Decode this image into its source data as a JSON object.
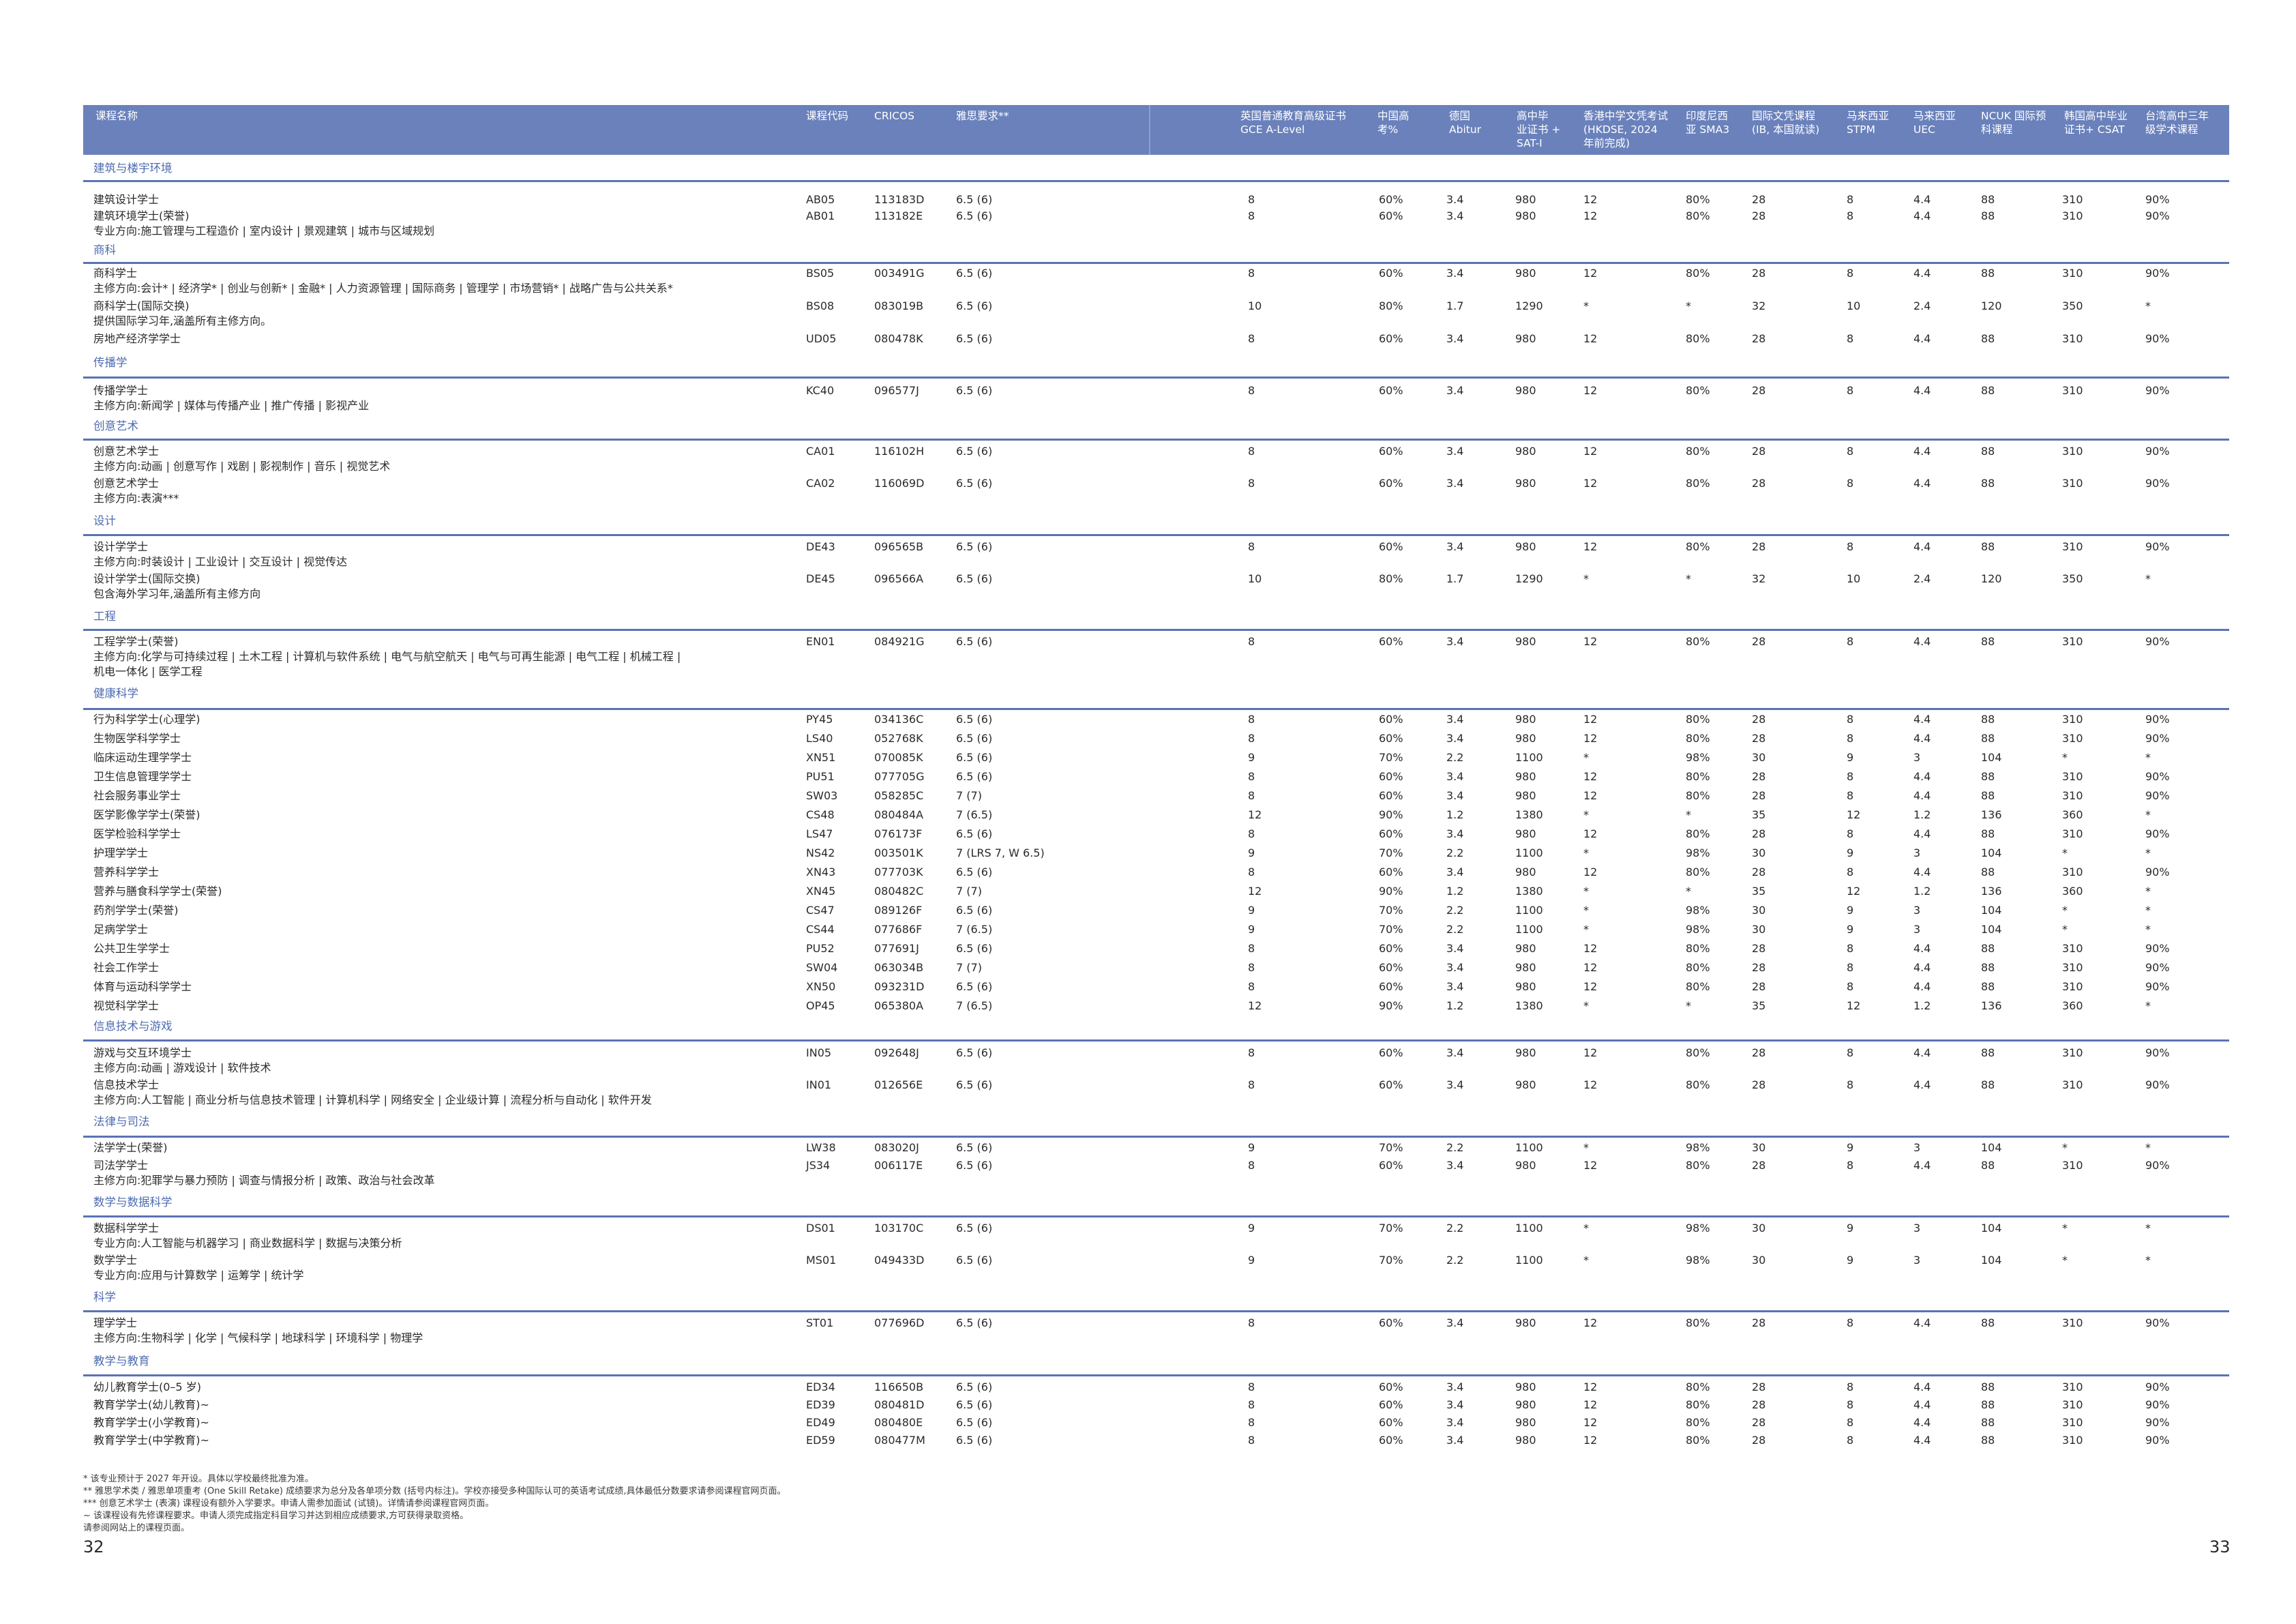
{
  "header": {
    "columns": [
      "课程名称",
      "课程代码",
      "CRICOS",
      "雅思要求**",
      "英国普通教育高级证书\nGCE A-Level",
      "中国高\n考%",
      "德国\nAbitur",
      "高中毕\n业证书 +\nSAT-I",
      "香港中学文凭考试\n(HKDSE, 2024\n年前完成)",
      "印度尼西\n亚 SMA3",
      "国际文凭课程\n(IB, 本国就读)",
      "马来西亚\nSTPM",
      "马来西亚\nUEC",
      "NCUK 国际预\n科课程",
      "韩国高中毕业\n证书+ CSAT",
      "台湾高中三年\n级学术课程"
    ]
  },
  "sections": [
    {
      "title": "建筑与楼宇环境",
      "rows": [
        {
          "name": "建筑设计学士",
          "code": "AB05",
          "cricos": "113183D",
          "ielts": "6.5 (6)",
          "vals": [
            "8",
            "60%",
            "3.4",
            "980",
            "12",
            "80%",
            "28",
            "8",
            "4.4",
            "88",
            "310",
            "90%"
          ]
        },
        {
          "name": "建筑环境学士(荣誉)",
          "sub": [
            "专业方向:施工管理与工程造价 | 室内设计 | 景观建筑 | 城市与区域规划"
          ],
          "code": "AB01",
          "cricos": "113182E",
          "ielts": "6.5 (6)",
          "vals": [
            "8",
            "60%",
            "3.4",
            "980",
            "12",
            "80%",
            "28",
            "8",
            "4.4",
            "88",
            "310",
            "90%"
          ]
        }
      ]
    },
    {
      "title": "商科",
      "rows": [
        {
          "name": "商科学士",
          "sub": [
            "主修方向:会计* | 经济学* | 创业与创新* | 金融* | 人力资源管理 | 国际商务 | 管理学 | 市场营销* | 战略广告与公共关系*"
          ],
          "code": "BS05",
          "cricos": "003491G",
          "ielts": "6.5 (6)",
          "vals": [
            "8",
            "60%",
            "3.4",
            "980",
            "12",
            "80%",
            "28",
            "8",
            "4.4",
            "88",
            "310",
            "90%"
          ]
        },
        {
          "name": "商科学士(国际交换)",
          "sub": [
            "提供国际学习年,涵盖所有主修方向。"
          ],
          "code": "BS08",
          "cricos": "083019B",
          "ielts": "6.5 (6)",
          "vals": [
            "10",
            "80%",
            "1.7",
            "1290",
            "*",
            "*",
            "32",
            "10",
            "2.4",
            "120",
            "350",
            "*"
          ]
        },
        {
          "name": "房地产经济学学士",
          "code": "UD05",
          "cricos": "080478K",
          "ielts": "6.5 (6)",
          "vals": [
            "8",
            "60%",
            "3.4",
            "980",
            "12",
            "80%",
            "28",
            "8",
            "4.4",
            "88",
            "310",
            "90%"
          ]
        }
      ]
    },
    {
      "title": "传播学",
      "rows": [
        {
          "name": "传播学学士",
          "sub": [
            "主修方向:新闻学 | 媒体与传播产业 | 推广传播 | 影视产业"
          ],
          "code": "KC40",
          "cricos": "096577J",
          "ielts": "6.5 (6)",
          "vals": [
            "8",
            "60%",
            "3.4",
            "980",
            "12",
            "80%",
            "28",
            "8",
            "4.4",
            "88",
            "310",
            "90%"
          ]
        }
      ]
    },
    {
      "title": "创意艺术",
      "rows": [
        {
          "name": "创意艺术学士",
          "sub": [
            "主修方向:动画 | 创意写作 | 戏剧 | 影视制作 | 音乐 | 视觉艺术"
          ],
          "code": "CA01",
          "cricos": "116102H",
          "ielts": "6.5 (6)",
          "vals": [
            "8",
            "60%",
            "3.4",
            "980",
            "12",
            "80%",
            "28",
            "8",
            "4.4",
            "88",
            "310",
            "90%"
          ]
        },
        {
          "name": "创意艺术学士",
          "sub": [
            "主修方向:表演***"
          ],
          "code": "CA02",
          "cricos": "116069D",
          "ielts": "6.5 (6)",
          "vals": [
            "8",
            "60%",
            "3.4",
            "980",
            "12",
            "80%",
            "28",
            "8",
            "4.4",
            "88",
            "310",
            "90%"
          ]
        }
      ]
    },
    {
      "title": "设计",
      "rows": [
        {
          "name": "设计学学士",
          "sub": [
            "主修方向:时装设计 | 工业设计 | 交互设计 | 视觉传达"
          ],
          "code": "DE43",
          "cricos": "096565B",
          "ielts": "6.5 (6)",
          "vals": [
            "8",
            "60%",
            "3.4",
            "980",
            "12",
            "80%",
            "28",
            "8",
            "4.4",
            "88",
            "310",
            "90%"
          ]
        },
        {
          "name": "设计学学士(国际交换)",
          "sub": [
            "包含海外学习年,涵盖所有主修方向"
          ],
          "code": "DE45",
          "cricos": "096566A",
          "ielts": "6.5 (6)",
          "vals": [
            "10",
            "80%",
            "1.7",
            "1290",
            "*",
            "*",
            "32",
            "10",
            "2.4",
            "120",
            "350",
            "*"
          ]
        }
      ]
    },
    {
      "title": "工程",
      "rows": [
        {
          "name": "工程学学士(荣誉)",
          "sub": [
            "主修方向:化学与可持续过程 | 土木工程 | 计算机与软件系统 | 电气与航空航天 | 电气与可再生能源 | 电气工程 | 机械工程 |",
            "机电一体化 | 医学工程"
          ],
          "code": "EN01",
          "cricos": "084921G",
          "ielts": "6.5 (6)",
          "vals": [
            "8",
            "60%",
            "3.4",
            "980",
            "12",
            "80%",
            "28",
            "8",
            "4.4",
            "88",
            "310",
            "90%"
          ]
        }
      ]
    },
    {
      "title": "健康科学",
      "rows": [
        {
          "name": "行为科学学士(心理学)",
          "code": "PY45",
          "cricos": "034136C",
          "ielts": "6.5 (6)",
          "vals": [
            "8",
            "60%",
            "3.4",
            "980",
            "12",
            "80%",
            "28",
            "8",
            "4.4",
            "88",
            "310",
            "90%"
          ]
        },
        {
          "name": "生物医学科学学士",
          "code": "LS40",
          "cricos": "052768K",
          "ielts": "6.5 (6)",
          "vals": [
            "8",
            "60%",
            "3.4",
            "980",
            "12",
            "80%",
            "28",
            "8",
            "4.4",
            "88",
            "310",
            "90%"
          ]
        },
        {
          "name": "临床运动生理学学士",
          "code": "XN51",
          "cricos": "070085K",
          "ielts": "6.5 (6)",
          "vals": [
            "9",
            "70%",
            "2.2",
            "1100",
            "*",
            "98%",
            "30",
            "9",
            "3",
            "104",
            "*",
            "*"
          ]
        },
        {
          "name": "卫生信息管理学学士",
          "code": "PU51",
          "cricos": "077705G",
          "ielts": "6.5 (6)",
          "vals": [
            "8",
            "60%",
            "3.4",
            "980",
            "12",
            "80%",
            "28",
            "8",
            "4.4",
            "88",
            "310",
            "90%"
          ]
        },
        {
          "name": "社会服务事业学士",
          "code": "SW03",
          "cricos": "058285C",
          "ielts": "7 (7)",
          "vals": [
            "8",
            "60%",
            "3.4",
            "980",
            "12",
            "80%",
            "28",
            "8",
            "4.4",
            "88",
            "310",
            "90%"
          ]
        },
        {
          "name": "医学影像学学士(荣誉)",
          "code": "CS48",
          "cricos": "080484A",
          "ielts": "7 (6.5)",
          "vals": [
            "12",
            "90%",
            "1.2",
            "1380",
            "*",
            "*",
            "35",
            "12",
            "1.2",
            "136",
            "360",
            "*"
          ]
        },
        {
          "name": "医学检验科学学士",
          "code": "LS47",
          "cricos": "076173F",
          "ielts": "6.5 (6)",
          "vals": [
            "8",
            "60%",
            "3.4",
            "980",
            "12",
            "80%",
            "28",
            "8",
            "4.4",
            "88",
            "310",
            "90%"
          ]
        },
        {
          "name": "护理学学士",
          "code": "NS42",
          "cricos": "003501K",
          "ielts": "7 (LRS 7, W 6.5)",
          "vals": [
            "9",
            "70%",
            "2.2",
            "1100",
            "*",
            "98%",
            "30",
            "9",
            "3",
            "104",
            "*",
            "*"
          ]
        },
        {
          "name": "营养科学学士",
          "code": "XN43",
          "cricos": "077703K",
          "ielts": "6.5 (6)",
          "vals": [
            "8",
            "60%",
            "3.4",
            "980",
            "12",
            "80%",
            "28",
            "8",
            "4.4",
            "88",
            "310",
            "90%"
          ]
        },
        {
          "name": "营养与膳食科学学士(荣誉)",
          "code": "XN45",
          "cricos": "080482C",
          "ielts": "7 (7)",
          "vals": [
            "12",
            "90%",
            "1.2",
            "1380",
            "*",
            "*",
            "35",
            "12",
            "1.2",
            "136",
            "360",
            "*"
          ]
        },
        {
          "name": "药剂学学士(荣誉)",
          "code": "CS47",
          "cricos": "089126F",
          "ielts": "6.5 (6)",
          "vals": [
            "9",
            "70%",
            "2.2",
            "1100",
            "*",
            "98%",
            "30",
            "9",
            "3",
            "104",
            "*",
            "*"
          ]
        },
        {
          "name": "足病学学士",
          "code": "CS44",
          "cricos": "077686F",
          "ielts": "7 (6.5)",
          "vals": [
            "9",
            "70%",
            "2.2",
            "1100",
            "*",
            "98%",
            "30",
            "9",
            "3",
            "104",
            "*",
            "*"
          ]
        },
        {
          "name": "公共卫生学学士",
          "code": "PU52",
          "cricos": "077691J",
          "ielts": "6.5 (6)",
          "vals": [
            "8",
            "60%",
            "3.4",
            "980",
            "12",
            "80%",
            "28",
            "8",
            "4.4",
            "88",
            "310",
            "90%"
          ]
        },
        {
          "name": "社会工作学士",
          "code": "SW04",
          "cricos": "063034B",
          "ielts": "7 (7)",
          "vals": [
            "8",
            "60%",
            "3.4",
            "980",
            "12",
            "80%",
            "28",
            "8",
            "4.4",
            "88",
            "310",
            "90%"
          ]
        },
        {
          "name": "体育与运动科学学士",
          "code": "XN50",
          "cricos": "093231D",
          "ielts": "6.5 (6)",
          "vals": [
            "8",
            "60%",
            "3.4",
            "980",
            "12",
            "80%",
            "28",
            "8",
            "4.4",
            "88",
            "310",
            "90%"
          ]
        },
        {
          "name": "视觉科学学士",
          "code": "OP45",
          "cricos": "065380A",
          "ielts": "7 (6.5)",
          "vals": [
            "12",
            "90%",
            "1.2",
            "1380",
            "*",
            "*",
            "35",
            "12",
            "1.2",
            "136",
            "360",
            "*"
          ]
        }
      ]
    },
    {
      "title": "信息技术与游戏",
      "rows": [
        {
          "name": "游戏与交互环境学士",
          "sub": [
            "主修方向:动画 | 游戏设计 | 软件技术"
          ],
          "code": "IN05",
          "cricos": "092648J",
          "ielts": "6.5 (6)",
          "vals": [
            "8",
            "60%",
            "3.4",
            "980",
            "12",
            "80%",
            "28",
            "8",
            "4.4",
            "88",
            "310",
            "90%"
          ]
        },
        {
          "name": "信息技术学士",
          "sub": [
            "主修方向:人工智能 | 商业分析与信息技术管理 | 计算机科学 | 网络安全 | 企业级计算 | 流程分析与自动化 | 软件开发"
          ],
          "code": "IN01",
          "cricos": "012656E",
          "ielts": "6.5 (6)",
          "vals": [
            "8",
            "60%",
            "3.4",
            "980",
            "12",
            "80%",
            "28",
            "8",
            "4.4",
            "88",
            "310",
            "90%"
          ]
        }
      ]
    },
    {
      "title": "法律与司法",
      "rows": [
        {
          "name": "法学学士(荣誉)",
          "code": "LW38",
          "cricos": "083020J",
          "ielts": "6.5 (6)",
          "vals": [
            "9",
            "70%",
            "2.2",
            "1100",
            "*",
            "98%",
            "30",
            "9",
            "3",
            "104",
            "*",
            "*"
          ]
        },
        {
          "name": "司法学学士",
          "sub": [
            "主修方向:犯罪学与暴力预防 | 调查与情报分析 | 政策、政治与社会改革"
          ],
          "code": "JS34",
          "cricos": "006117E",
          "ielts": "6.5 (6)",
          "vals": [
            "8",
            "60%",
            "3.4",
            "980",
            "12",
            "80%",
            "28",
            "8",
            "4.4",
            "88",
            "310",
            "90%"
          ]
        }
      ]
    },
    {
      "title": "数学与数据科学",
      "rows": [
        {
          "name": "数据科学学士",
          "sub": [
            "专业方向:人工智能与机器学习 | 商业数据科学 | 数据与决策分析"
          ],
          "code": "DS01",
          "cricos": "103170C",
          "ielts": "6.5 (6)",
          "vals": [
            "9",
            "70%",
            "2.2",
            "1100",
            "*",
            "98%",
            "30",
            "9",
            "3",
            "104",
            "*",
            "*"
          ]
        },
        {
          "name": "数学学士",
          "sub": [
            "专业方向:应用与计算数学 | 运筹学 | 统计学"
          ],
          "code": "MS01",
          "cricos": "049433D",
          "ielts": "6.5 (6)",
          "vals": [
            "9",
            "70%",
            "2.2",
            "1100",
            "*",
            "98%",
            "30",
            "9",
            "3",
            "104",
            "*",
            "*"
          ]
        }
      ]
    },
    {
      "title": "科学",
      "rows": [
        {
          "name": "理学学士",
          "sub": [
            "主修方向:生物科学 | 化学 | 气候科学 | 地球科学 | 环境科学 | 物理学"
          ],
          "code": "ST01",
          "cricos": "077696D",
          "ielts": "6.5 (6)",
          "vals": [
            "8",
            "60%",
            "3.4",
            "980",
            "12",
            "80%",
            "28",
            "8",
            "4.4",
            "88",
            "310",
            "90%"
          ]
        }
      ]
    },
    {
      "title": "教学与教育",
      "rows": [
        {
          "name": "幼儿教育学士(0–5 岁)",
          "code": "ED34",
          "cricos": "116650B",
          "ielts": "6.5 (6)",
          "vals": [
            "8",
            "60%",
            "3.4",
            "980",
            "12",
            "80%",
            "28",
            "8",
            "4.4",
            "88",
            "310",
            "90%"
          ]
        },
        {
          "name": "教育学学士(幼儿教育)~",
          "code": "ED39",
          "cricos": "080481D",
          "ielts": "6.5 (6)",
          "vals": [
            "8",
            "60%",
            "3.4",
            "980",
            "12",
            "80%",
            "28",
            "8",
            "4.4",
            "88",
            "310",
            "90%"
          ]
        },
        {
          "name": "教育学学士(小学教育)~",
          "code": "ED49",
          "cricos": "080480E",
          "ielts": "6.5 (6)",
          "vals": [
            "8",
            "60%",
            "3.4",
            "980",
            "12",
            "80%",
            "28",
            "8",
            "4.4",
            "88",
            "310",
            "90%"
          ]
        },
        {
          "name": "教育学学士(中学教育)~",
          "code": "ED59",
          "cricos": "080477M",
          "ielts": "6.5 (6)",
          "vals": [
            "8",
            "60%",
            "3.4",
            "980",
            "12",
            "80%",
            "28",
            "8",
            "4.4",
            "88",
            "310",
            "90%"
          ]
        }
      ]
    }
  ],
  "footnotes": [
    "*    该专业预计于 2027 年开设。具体以学校最终批准为准。",
    "**   雅思学术类 / 雅思单项重考 (One Skill Retake) 成绩要求为总分及各单项分数 (括号内标注)。学校亦接受多种国际认可的英语考试成绩,具体最低分数要求请参阅课程官网页面。",
    "***  创意艺术学士 (表演) 课程设有额外入学要求。申请人需参加面试 (试镜)。详情请参阅课程官网页面。",
    "~    该课程设有先修课程要求。申请人须完成指定科目学习并达到相应成绩要求,方可获得录取资格。",
    "请参阅网站上的课程页面。"
  ],
  "page_numbers": {
    "left": "32",
    "right": "33"
  },
  "colors": {
    "header_bg": "#6a81bb",
    "section_title": "#4d6bb0",
    "rule": "#5a73b3"
  }
}
